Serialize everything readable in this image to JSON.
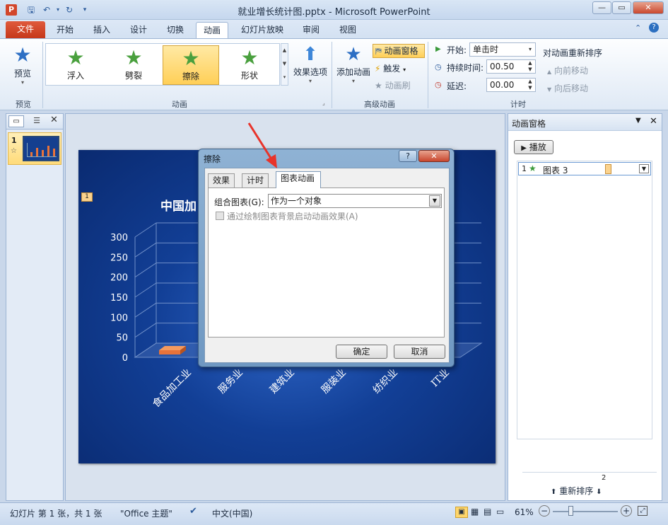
{
  "window": {
    "title": "就业增长统计图.pptx - Microsoft PowerPoint",
    "app_icon": "P",
    "minimize": "—",
    "restore": "▭",
    "close": "✕"
  },
  "tabs": {
    "file": "文件",
    "items": [
      "开始",
      "插入",
      "设计",
      "切换",
      "动画",
      "幻灯片放映",
      "审阅",
      "视图"
    ],
    "active": "动画"
  },
  "ribbon": {
    "preview": {
      "label": "预览",
      "group": "预览"
    },
    "animation_gallery": {
      "items": [
        "浮入",
        "劈裂",
        "擦除",
        "形状"
      ],
      "selected": "擦除",
      "group": "动画"
    },
    "effect_options": "效果选项",
    "advanced": {
      "add_animation": "添加动画",
      "animation_pane": "动画窗格",
      "trigger": "触发",
      "animation_painter": "动画刷",
      "group": "高级动画"
    },
    "timing": {
      "start_label": "开始:",
      "start_value": "单击时",
      "duration_label": "持续时间:",
      "duration_value": "00.50",
      "delay_label": "延迟:",
      "delay_value": "00.00",
      "reorder_title": "对动画重新排序",
      "move_earlier": "向前移动",
      "move_later": "向后移动",
      "group": "计时"
    }
  },
  "slides_pane": {
    "slide_number": "1",
    "star_marker": "☆"
  },
  "slide": {
    "animation_tag": "1",
    "chart_title_visible": "中国加",
    "categories": [
      "食品加工业",
      "服务业",
      "建筑业",
      "服装业",
      "纺织业",
      "IT业"
    ]
  },
  "chart_data": {
    "type": "bar",
    "title": "中国加",
    "categories": [
      "食品加工业",
      "服务业",
      "建筑业",
      "服装业",
      "纺织业",
      "IT业"
    ],
    "values": [
      7,
      null,
      null,
      null,
      null,
      null
    ],
    "ylim": [
      0,
      300
    ],
    "yticks": [
      0,
      50,
      100,
      150,
      200,
      250,
      300
    ]
  },
  "animation_pane": {
    "title": "动画窗格",
    "play_button": "播放",
    "items": [
      {
        "index": "1",
        "name": "图表 3"
      }
    ],
    "reorder_label": "重新排序",
    "page": "2"
  },
  "dialog": {
    "title": "擦除",
    "help": "?",
    "close": "✕",
    "tabs": [
      "效果",
      "计时",
      "图表动画"
    ],
    "active_tab": "图表动画",
    "group_chart_label": "组合图表(G):",
    "group_chart_value": "作为一个对象",
    "background_checkbox_label": "通过绘制图表背景启动动画效果(A)",
    "ok": "确定",
    "cancel": "取消"
  },
  "statusbar": {
    "slide_info": "幻灯片 第 1 张，共 1 张",
    "theme": "\"Office 主题\"",
    "language": "中文(中国)",
    "zoom": "61%"
  },
  "colors": {
    "accent_orange": "#e8733a",
    "ribbon_selected": "#ffcf57",
    "slide_bg": "#123f96",
    "file_tab": "#d2462b"
  }
}
